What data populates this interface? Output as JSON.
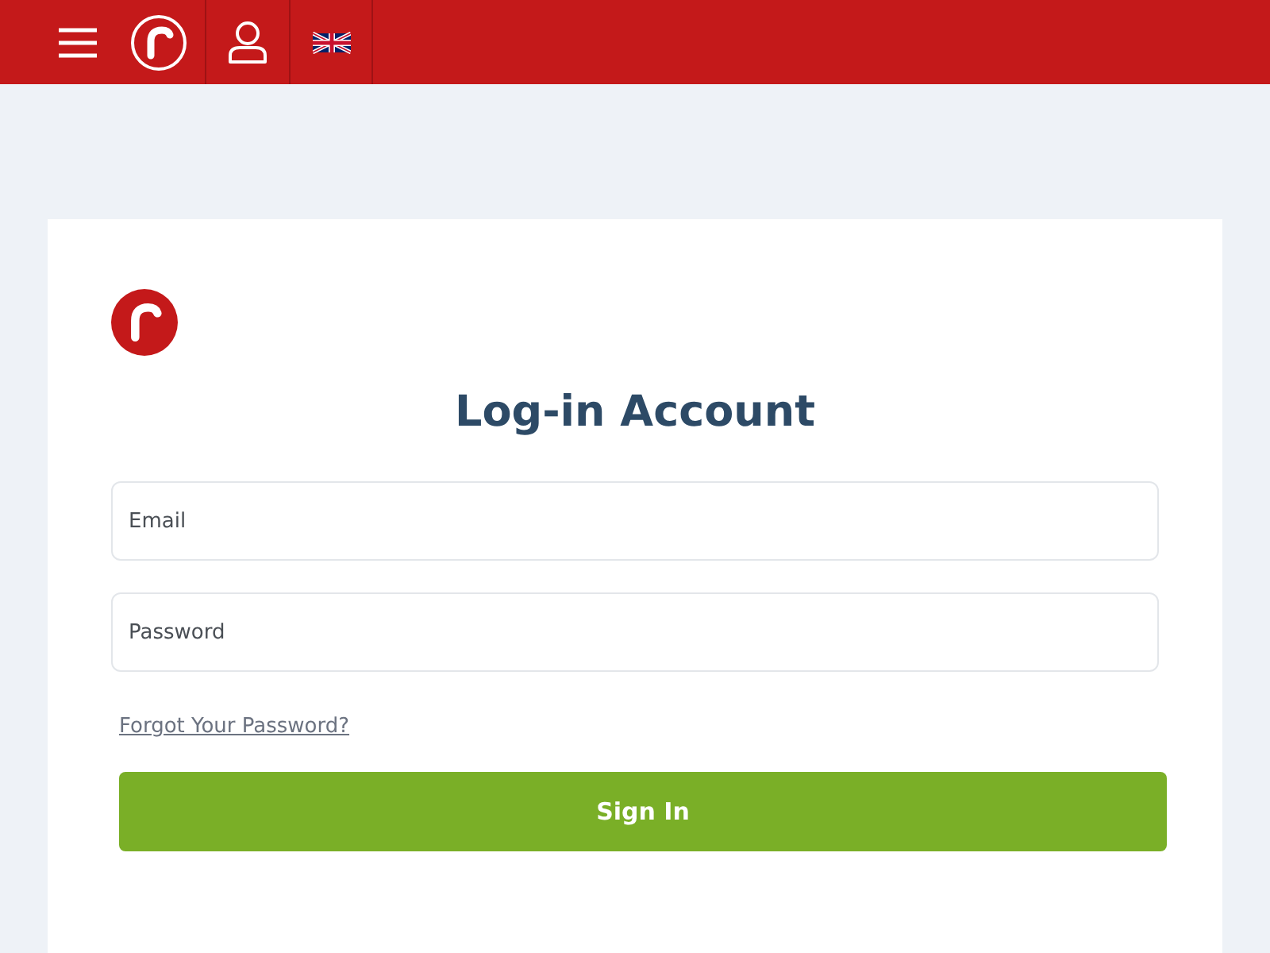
{
  "header": {
    "nav": [
      {
        "kind": "menu"
      },
      {
        "kind": "logo"
      },
      {
        "kind": "account"
      },
      {
        "kind": "language"
      }
    ]
  },
  "login": {
    "title": "Log-in Account",
    "fields": [
      {
        "placeholder": "Email"
      },
      {
        "placeholder": "Password"
      }
    ],
    "forgot_link": "Forgot Your Password?",
    "submit": "Sign In"
  }
}
